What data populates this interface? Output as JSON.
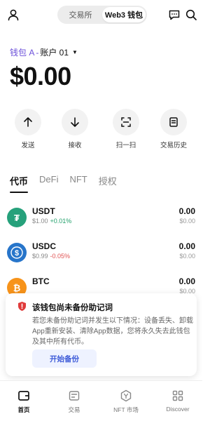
{
  "header": {
    "segment_tabs": [
      {
        "label": "交易所",
        "active": false
      },
      {
        "label": "Web3 钱包",
        "active": true
      }
    ],
    "profile_icon": "person-icon",
    "chat_icon": "chat-icon",
    "search_icon": "search-icon"
  },
  "wallet": {
    "name": "钱包 A",
    "separator": "-",
    "account": "账户 01",
    "balance": "$0.00"
  },
  "actions": [
    {
      "label": "发送",
      "icon": "arrow-up-icon"
    },
    {
      "label": "接收",
      "icon": "arrow-down-icon"
    },
    {
      "label": "扫一扫",
      "icon": "scan-icon"
    },
    {
      "label": "交易历史",
      "icon": "history-icon"
    }
  ],
  "tabs": [
    {
      "label": "代币",
      "active": true
    },
    {
      "label": "DeFi",
      "active": false
    },
    {
      "label": "NFT",
      "active": false
    },
    {
      "label": "授权",
      "active": false
    }
  ],
  "tokens": [
    {
      "symbol": "USDT",
      "price": "$1.00",
      "change": "+0.01%",
      "change_color": "#22a06b",
      "amount": "0.00",
      "value": "$0.00",
      "coin_color": "#26a17b"
    },
    {
      "symbol": "USDC",
      "price": "$0.99",
      "change": "-0.05%",
      "change_color": "#e05252",
      "amount": "0.00",
      "value": "$0.00",
      "coin_color": "#2775ca"
    },
    {
      "symbol": "BTC",
      "price": "",
      "change": "",
      "change_color": "#e05252",
      "amount": "0.00",
      "value": "$0.00",
      "coin_color": "#f7931a"
    }
  ],
  "backup_warning": {
    "title": "该钱包尚未备份助记词",
    "description": "若您未备份助记词并发生以下情况：设备丢失、卸载App重新安装、清除App数据，您将永久失去此钱包及其中所有代币。",
    "button": "开始备份",
    "accent_color": "#e03b3b"
  },
  "bottom_nav": [
    {
      "label": "首页",
      "icon": "wallet-icon",
      "active": true
    },
    {
      "label": "交易",
      "icon": "trade-icon",
      "active": false
    },
    {
      "label": "NFT 市场",
      "icon": "nft-market-icon",
      "active": false
    },
    {
      "label": "Discover",
      "icon": "discover-grid-icon",
      "active": false
    }
  ]
}
